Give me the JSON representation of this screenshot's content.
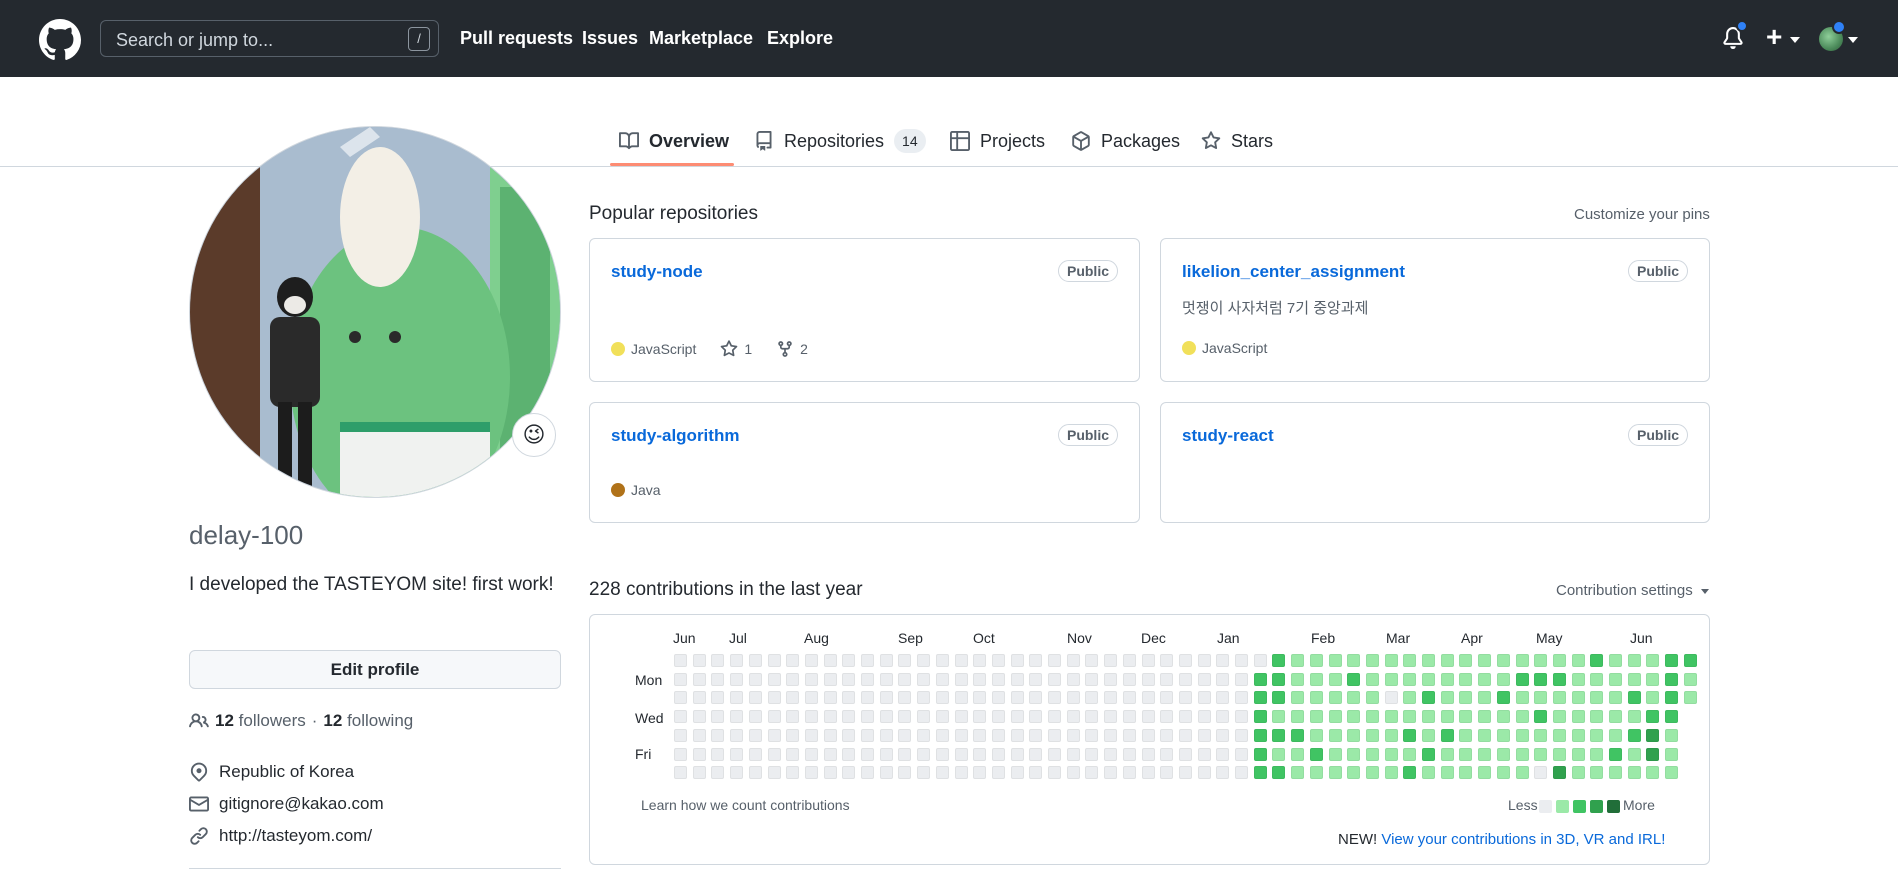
{
  "header": {
    "search_placeholder": "Search or jump to...",
    "search_shortcut": "/",
    "nav": [
      "Pull requests",
      "Issues",
      "Marketplace",
      "Explore"
    ],
    "plus_label": "+"
  },
  "tabs": [
    {
      "label": "Overview",
      "icon": "book-icon",
      "active": true
    },
    {
      "label": "Repositories",
      "icon": "repo-icon",
      "count": "14"
    },
    {
      "label": "Projects",
      "icon": "table-icon"
    },
    {
      "label": "Packages",
      "icon": "package-icon"
    },
    {
      "label": "Stars",
      "icon": "star-icon"
    }
  ],
  "profile": {
    "status_emoji": "😉",
    "username": "delay-100",
    "bio": "I developed the TASTEYOM site! first work!",
    "edit_button": "Edit profile",
    "followers_count": "12",
    "followers_label": "followers",
    "separator": "·",
    "following_count": "12",
    "following_label": "following",
    "location": "Republic of Korea",
    "email": "gitignore@kakao.com",
    "website": "http://tasteyom.com/"
  },
  "popular": {
    "title": "Popular repositories",
    "customize": "Customize your pins",
    "repos": [
      {
        "name": "study-node",
        "visibility": "Public",
        "description": "",
        "language": "JavaScript",
        "lang_color": "#f1e05a",
        "stars": "1",
        "forks": "2"
      },
      {
        "name": "likelion_center_assignment",
        "visibility": "Public",
        "description": "멋쟁이 사자처럼 7기 중앙과제",
        "language": "JavaScript",
        "lang_color": "#f1e05a"
      },
      {
        "name": "study-algorithm",
        "visibility": "Public",
        "description": "",
        "language": "Java",
        "lang_color": "#b07219"
      },
      {
        "name": "study-react",
        "visibility": "Public",
        "description": ""
      }
    ]
  },
  "contributions": {
    "title": "228 contributions in the last year",
    "settings": "Contribution settings",
    "months": [
      "Jun",
      "Jul",
      "Aug",
      "Sep",
      "Oct",
      "Nov",
      "Dec",
      "Jan",
      "Feb",
      "Mar",
      "Apr",
      "May",
      "Jun"
    ],
    "days": [
      "Mon",
      "Wed",
      "Fri"
    ],
    "learn": "Learn how we count contributions",
    "less": "Less",
    "more": "More",
    "new_label": "NEW!",
    "new_link": "View your contributions in 3D, VR and IRL!",
    "colors": [
      "#ebedf0",
      "#9be9a8",
      "#40c463",
      "#30a14e",
      "#216e39"
    ],
    "weeks": [
      [
        0,
        0,
        0,
        0,
        0,
        0,
        0
      ],
      [
        0,
        0,
        0,
        0,
        0,
        0,
        0
      ],
      [
        0,
        0,
        0,
        0,
        0,
        0,
        0
      ],
      [
        0,
        0,
        0,
        0,
        0,
        0,
        0
      ],
      [
        0,
        0,
        0,
        0,
        0,
        0,
        0
      ],
      [
        0,
        0,
        0,
        0,
        0,
        0,
        0
      ],
      [
        0,
        0,
        0,
        0,
        0,
        0,
        0
      ],
      [
        0,
        0,
        0,
        0,
        0,
        0,
        0
      ],
      [
        0,
        0,
        0,
        0,
        0,
        0,
        0
      ],
      [
        0,
        0,
        0,
        0,
        0,
        0,
        0
      ],
      [
        0,
        0,
        0,
        0,
        0,
        0,
        0
      ],
      [
        0,
        0,
        0,
        0,
        0,
        0,
        0
      ],
      [
        0,
        0,
        0,
        0,
        0,
        0,
        0
      ],
      [
        0,
        0,
        0,
        0,
        0,
        0,
        0
      ],
      [
        0,
        0,
        0,
        0,
        0,
        0,
        0
      ],
      [
        0,
        0,
        0,
        0,
        0,
        0,
        0
      ],
      [
        0,
        0,
        0,
        0,
        0,
        0,
        0
      ],
      [
        0,
        0,
        0,
        0,
        0,
        0,
        0
      ],
      [
        0,
        0,
        0,
        0,
        0,
        0,
        0
      ],
      [
        0,
        0,
        0,
        0,
        0,
        0,
        0
      ],
      [
        0,
        0,
        0,
        0,
        0,
        0,
        0
      ],
      [
        0,
        0,
        0,
        0,
        0,
        0,
        0
      ],
      [
        0,
        0,
        0,
        0,
        0,
        0,
        0
      ],
      [
        0,
        0,
        0,
        0,
        0,
        0,
        0
      ],
      [
        0,
        0,
        0,
        0,
        0,
        0,
        0
      ],
      [
        0,
        0,
        0,
        0,
        0,
        0,
        0
      ],
      [
        0,
        0,
        0,
        0,
        0,
        0,
        0
      ],
      [
        0,
        0,
        0,
        0,
        0,
        0,
        0
      ],
      [
        0,
        0,
        0,
        0,
        0,
        0,
        0
      ],
      [
        0,
        0,
        0,
        0,
        0,
        0,
        0
      ],
      [
        0,
        0,
        0,
        0,
        0,
        0,
        0
      ],
      [
        0,
        2,
        2,
        2,
        2,
        2,
        2
      ],
      [
        2,
        2,
        2,
        1,
        2,
        1,
        2
      ],
      [
        1,
        1,
        1,
        1,
        2,
        1,
        1
      ],
      [
        1,
        1,
        1,
        1,
        1,
        2,
        1
      ],
      [
        1,
        1,
        1,
        1,
        1,
        1,
        1
      ],
      [
        1,
        2,
        1,
        1,
        1,
        1,
        1
      ],
      [
        1,
        1,
        1,
        1,
        1,
        1,
        1
      ],
      [
        1,
        1,
        0,
        1,
        1,
        1,
        1
      ],
      [
        1,
        1,
        1,
        1,
        2,
        1,
        2
      ],
      [
        1,
        1,
        2,
        1,
        1,
        2,
        1
      ],
      [
        1,
        1,
        1,
        1,
        2,
        1,
        1
      ],
      [
        1,
        1,
        1,
        1,
        1,
        1,
        1
      ],
      [
        1,
        1,
        1,
        1,
        1,
        1,
        1
      ],
      [
        1,
        1,
        2,
        1,
        1,
        1,
        1
      ],
      [
        1,
        2,
        1,
        1,
        1,
        1,
        1
      ],
      [
        1,
        2,
        1,
        2,
        1,
        1,
        0
      ],
      [
        1,
        2,
        1,
        1,
        1,
        1,
        3
      ],
      [
        1,
        1,
        1,
        1,
        1,
        1,
        1
      ],
      [
        2,
        1,
        1,
        1,
        1,
        1,
        1
      ],
      [
        1,
        1,
        1,
        1,
        1,
        2,
        1
      ],
      [
        1,
        1,
        2,
        1,
        2,
        1,
        1
      ],
      [
        1,
        1,
        1,
        2,
        3,
        3,
        1
      ],
      [
        2,
        2,
        2,
        2,
        1,
        1,
        1
      ],
      [
        2,
        1,
        1
      ]
    ]
  }
}
